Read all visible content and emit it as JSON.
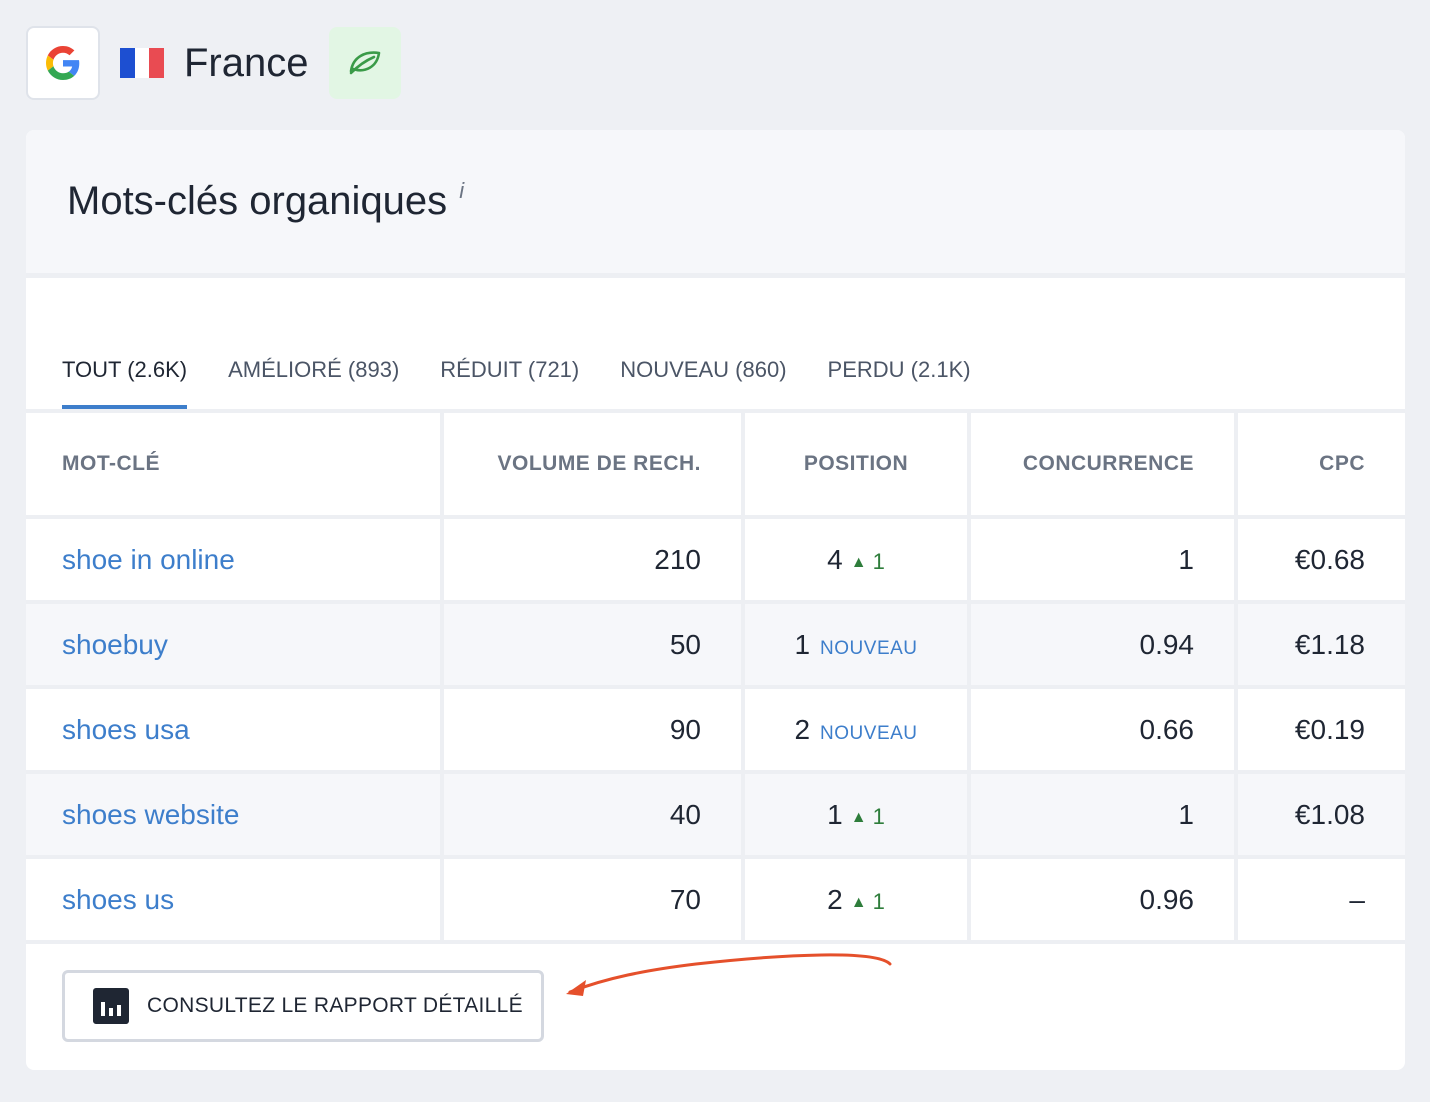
{
  "header": {
    "search_engine_icon": "google-g-icon",
    "country": "France",
    "flag_colors": [
      "#1d4fd1",
      "#ffffff",
      "#e94b52"
    ],
    "mode_icon": "leaf-icon"
  },
  "card": {
    "title": "Mots-clés organiques",
    "info_symbol": "i"
  },
  "tabs": [
    {
      "label": "TOUT (2.6K)",
      "active": true
    },
    {
      "label": "AMÉLIORÉ (893)",
      "active": false
    },
    {
      "label": "RÉDUIT (721)",
      "active": false
    },
    {
      "label": "NOUVEAU (860)",
      "active": false
    },
    {
      "label": "PERDU (2.1K)",
      "active": false
    }
  ],
  "table": {
    "columns": [
      "MOT-CLÉ",
      "VOLUME DE RECH.",
      "POSITION",
      "CONCURRENCE",
      "CPC"
    ],
    "rows": [
      {
        "keyword": "shoe in online",
        "volume": "210",
        "position": "4",
        "change": "1",
        "new_label": "",
        "competition": "1",
        "cpc": "€0.68"
      },
      {
        "keyword": "shoebuy",
        "volume": "50",
        "position": "1",
        "change": "",
        "new_label": "NOUVEAU",
        "competition": "0.94",
        "cpc": "€1.18"
      },
      {
        "keyword": "shoes usa",
        "volume": "90",
        "position": "2",
        "change": "",
        "new_label": "NOUVEAU",
        "competition": "0.66",
        "cpc": "€0.19"
      },
      {
        "keyword": "shoes website",
        "volume": "40",
        "position": "1",
        "change": "1",
        "new_label": "",
        "competition": "1",
        "cpc": "€1.08"
      },
      {
        "keyword": "shoes us",
        "volume": "70",
        "position": "2",
        "change": "1",
        "new_label": "",
        "competition": "0.96",
        "cpc": "–"
      }
    ]
  },
  "footer": {
    "report_button_label": "CONSULTEZ LE RAPPORT DÉTAILLÉ",
    "report_icon": "bar-chart-icon"
  },
  "colors": {
    "link": "#3d7ecb",
    "positive_change": "#2e7d3b",
    "annotation_arrow": "#e5502b"
  }
}
